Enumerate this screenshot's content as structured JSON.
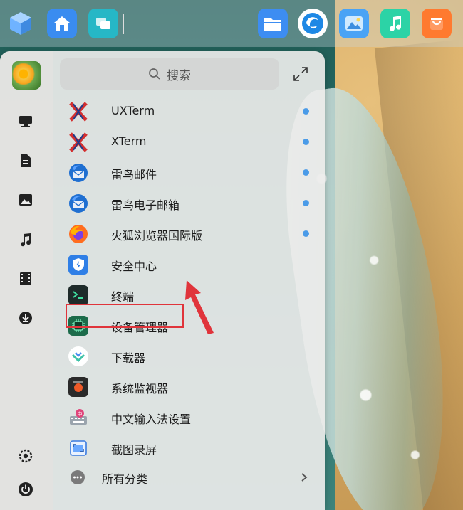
{
  "search": {
    "placeholder": "搜索"
  },
  "apps": [
    {
      "label": "UXTerm",
      "icon": "xterm-icon",
      "new": true
    },
    {
      "label": "XTerm",
      "icon": "xterm-icon",
      "new": true
    },
    {
      "label": "雷鸟邮件",
      "icon": "thunderbird-icon",
      "new": true
    },
    {
      "label": "雷鸟电子邮箱",
      "icon": "thunderbird-icon",
      "new": true
    },
    {
      "label": "火狐浏览器国际版",
      "icon": "firefox-icon",
      "new": true
    },
    {
      "label": "安全中心",
      "icon": "security-shield-icon",
      "new": false
    },
    {
      "label": "终端",
      "icon": "terminal-icon",
      "new": false
    },
    {
      "label": "设备管理器",
      "icon": "device-manager-icon",
      "new": false
    },
    {
      "label": "下载器",
      "icon": "downloader-icon",
      "new": false
    },
    {
      "label": "系统监视器",
      "icon": "system-monitor-icon",
      "new": false
    },
    {
      "label": "中文输入法设置",
      "icon": "input-method-icon",
      "new": false
    },
    {
      "label": "截图录屏",
      "icon": "screenshot-icon",
      "new": false
    }
  ],
  "more": {
    "label": "所有分类"
  },
  "colors": {
    "accent": "#4a9be8",
    "highlight": "#e0343b",
    "arrow": "#e0343b"
  }
}
